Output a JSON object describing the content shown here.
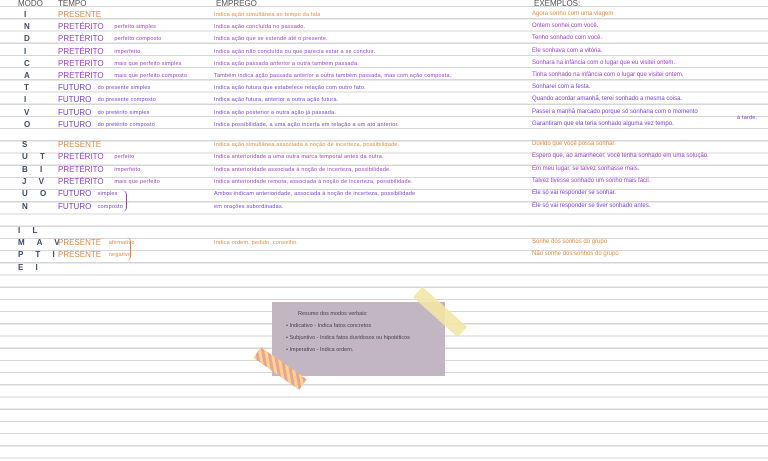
{
  "headers": {
    "mode": "MODO",
    "tense": "TEMPO",
    "usage": "EMPREGO",
    "examples": "EXEMPLOS:"
  },
  "indicativo": {
    "letters": [
      "I",
      "N",
      "D",
      "I",
      "C",
      "A",
      "T",
      "I",
      "V",
      "O"
    ],
    "rows": [
      {
        "tense": "PRESENTE",
        "sub": "",
        "usage": "Indica ação simultânea ao tempo da fala",
        "example": "Agora sonho com uma viagem"
      },
      {
        "tense": "PRETÉRITO",
        "sub": "perfeito simples",
        "usage": "Indica ação concluída no passado.",
        "example": "Ontem sonhei com você."
      },
      {
        "tense": "PRETÉRITO",
        "sub": "perfeito composto",
        "usage": "Indica ação que se estende até o presente.",
        "example": "Tenho sonhado com você."
      },
      {
        "tense": "PRETÉRITO",
        "sub": "imperfeito",
        "usage": "Indica ação não concluída ou que parecia estar a se concluir.",
        "example": "Ele sonhava com a vitória."
      },
      {
        "tense": "PRETÉRITO",
        "sub": "mais que perfeito simples",
        "usage": "Indica ação passada anterior a outra também passada.",
        "example": "Sonhara na infância com o lugar que eu visitei ontem."
      },
      {
        "tense": "PRETÉRITO",
        "sub": "mais que perfeito composto",
        "usage": "Também indica ação passada anterior a outra também passada, mas com ação composta.",
        "example": "Tinha sonhado na infância com o lugar que visitei ontem."
      },
      {
        "tense": "FUTURO",
        "sub": "do presente simples",
        "usage": "Indica ação futura que estabelece relação com outro fato.",
        "example": "Sonharei com a festa."
      },
      {
        "tense": "FUTURO",
        "sub": "do presente composto",
        "usage": "Indica ação futura, anterior a outra ação futura.",
        "example": "Quando acordar amanhã, terei sonhado a mesma coisa."
      },
      {
        "tense": "FUTURO",
        "sub": "do pretérito simples",
        "usage": "Indica ação posterior a outra ação já passada.",
        "example": "Passei a manhã marcado porque só sonharia com o momento",
        "example_extra": "à tarde."
      },
      {
        "tense": "FUTURO",
        "sub": "do pretérito composto",
        "usage": "Indica possibilidade, a uma ação incerta em relação a um ato anterior.",
        "example": "Garantiram que ela teria sonhado alguma vez tempo."
      }
    ]
  },
  "subjuntivo": {
    "letters": [
      "S",
      "U T",
      "B I",
      "J V",
      "U O",
      "N"
    ],
    "rows": [
      {
        "tense": "PRESENTE",
        "sub": "",
        "usage": "Indica ação simultânea associada à noção de incerteza, possibilidade.",
        "example": "Duvido que você possa sonhar."
      },
      {
        "tense": "PRETÉRITO",
        "sub": "perfeito",
        "usage": "Indica anterioridade a uma outra marca temporal antes da outra.",
        "example": "Espero que, ao amanhecer, você tenha sonhado em uma solução."
      },
      {
        "tense": "PRETÉRITO",
        "sub": "imperfeito",
        "usage": "Indica anterioridade associada à noção de incerteza, possibilidade.",
        "example": "Em meu lugar, se talvez sonhasse mais."
      },
      {
        "tense": "PRETÉRITO",
        "sub": "mais que perfeito",
        "usage": "Indica anterioridade remota, associada à noção de incerteza, possibilidade.",
        "example": "Talvez tivesse sonhado um sonho mais fácil."
      },
      {
        "tense": "FUTURO",
        "sub": "simples",
        "usage": "Ambos indicam anterioridade, associada à noção de incerteza, possibilidade",
        "example": "Ele só vai responder se sonhar."
      },
      {
        "tense": "FUTURO",
        "sub": "composto",
        "usage": "em orações subordinadas.",
        "example": "Ele só vai responder se tiver sonhado antes."
      }
    ]
  },
  "imperativo": {
    "letters": [
      "I L",
      "M A V",
      "P T I",
      "E I"
    ],
    "rows": [
      {
        "tense": "PRESENTE",
        "sub": "afirmativo",
        "usage": "Indica ordem, pedido, conselho.",
        "example": "Sonhe dos sonhos do grupo"
      },
      {
        "tense": "PRESENTE",
        "sub": "negativo",
        "usage": "",
        "example": "Não sonhe dos sonhos do grupo"
      }
    ]
  },
  "note": {
    "title": "Resumo dos modos verbais:",
    "items": [
      "• Indicativo - Indica fatos concretos",
      "• Subjuntivo - Indica fatos duvidosos ou hipotéticos",
      "• Imperativo - Indica ordem."
    ]
  },
  "colors": {
    "presente": "#e0893a",
    "preterito": "#9a3dc9",
    "futuro": "#7440d6",
    "mode": "#3d4a66",
    "note": "#c3b6c3"
  }
}
